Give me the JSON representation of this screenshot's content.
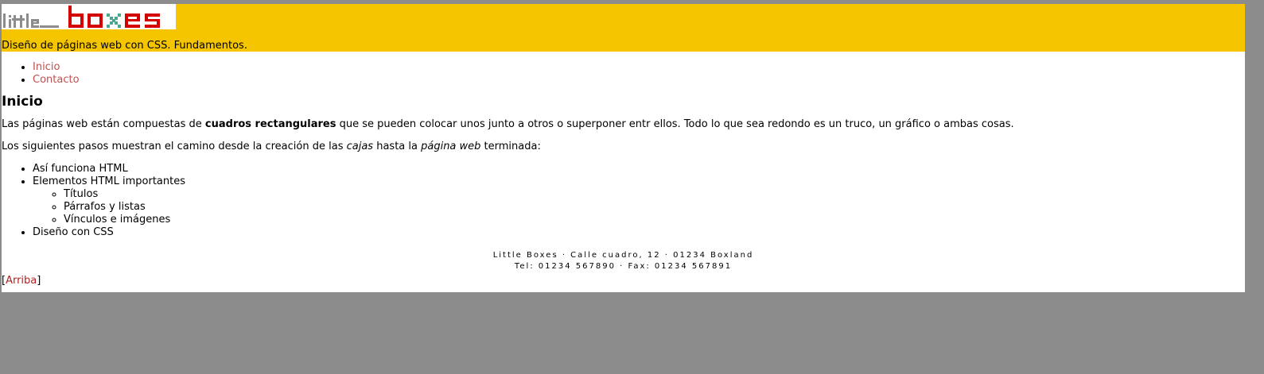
{
  "header": {
    "logo_text": "little boxes",
    "tagline": "Diseño de páginas web con CSS. Fundamentos."
  },
  "nav": {
    "items": [
      {
        "label": "Inicio"
      },
      {
        "label": "Contacto"
      }
    ]
  },
  "content": {
    "heading": "Inicio",
    "p1": {
      "before": "Las páginas web están compuestas de ",
      "strong": "cuadros rectangulares",
      "after": " que se pueden colocar unos junto a otros o superponer entr ellos. Todo lo que sea redondo es un truco, un gráfico o ambas cosas."
    },
    "p2": {
      "before": "Los siguientes pasos muestran el camino desde la creación de las ",
      "em1": "cajas",
      "middle": " hasta la ",
      "em2": "página web",
      "after": " terminada:"
    },
    "steps": [
      {
        "label": "Así funciona HTML"
      },
      {
        "label": "Elementos HTML importantes",
        "children": [
          "Títulos",
          "Párrafos y listas",
          "Vínculos e imágenes"
        ]
      },
      {
        "label": "Diseño con CSS"
      }
    ]
  },
  "footer": {
    "line1": "Little Boxes · Calle cuadro, 12 · 01234 Boxland",
    "line2": "Tel: 01234 567890 · Fax: 01234 567891"
  },
  "top_link": {
    "open": "[",
    "label": "Arriba",
    "close": "]"
  },
  "colors": {
    "header_bg": "#f5c600",
    "logo_red": "#d40000",
    "logo_gray": "#8c8c8c",
    "logo_teal": "#4aa88e",
    "link": "#c0504d"
  }
}
